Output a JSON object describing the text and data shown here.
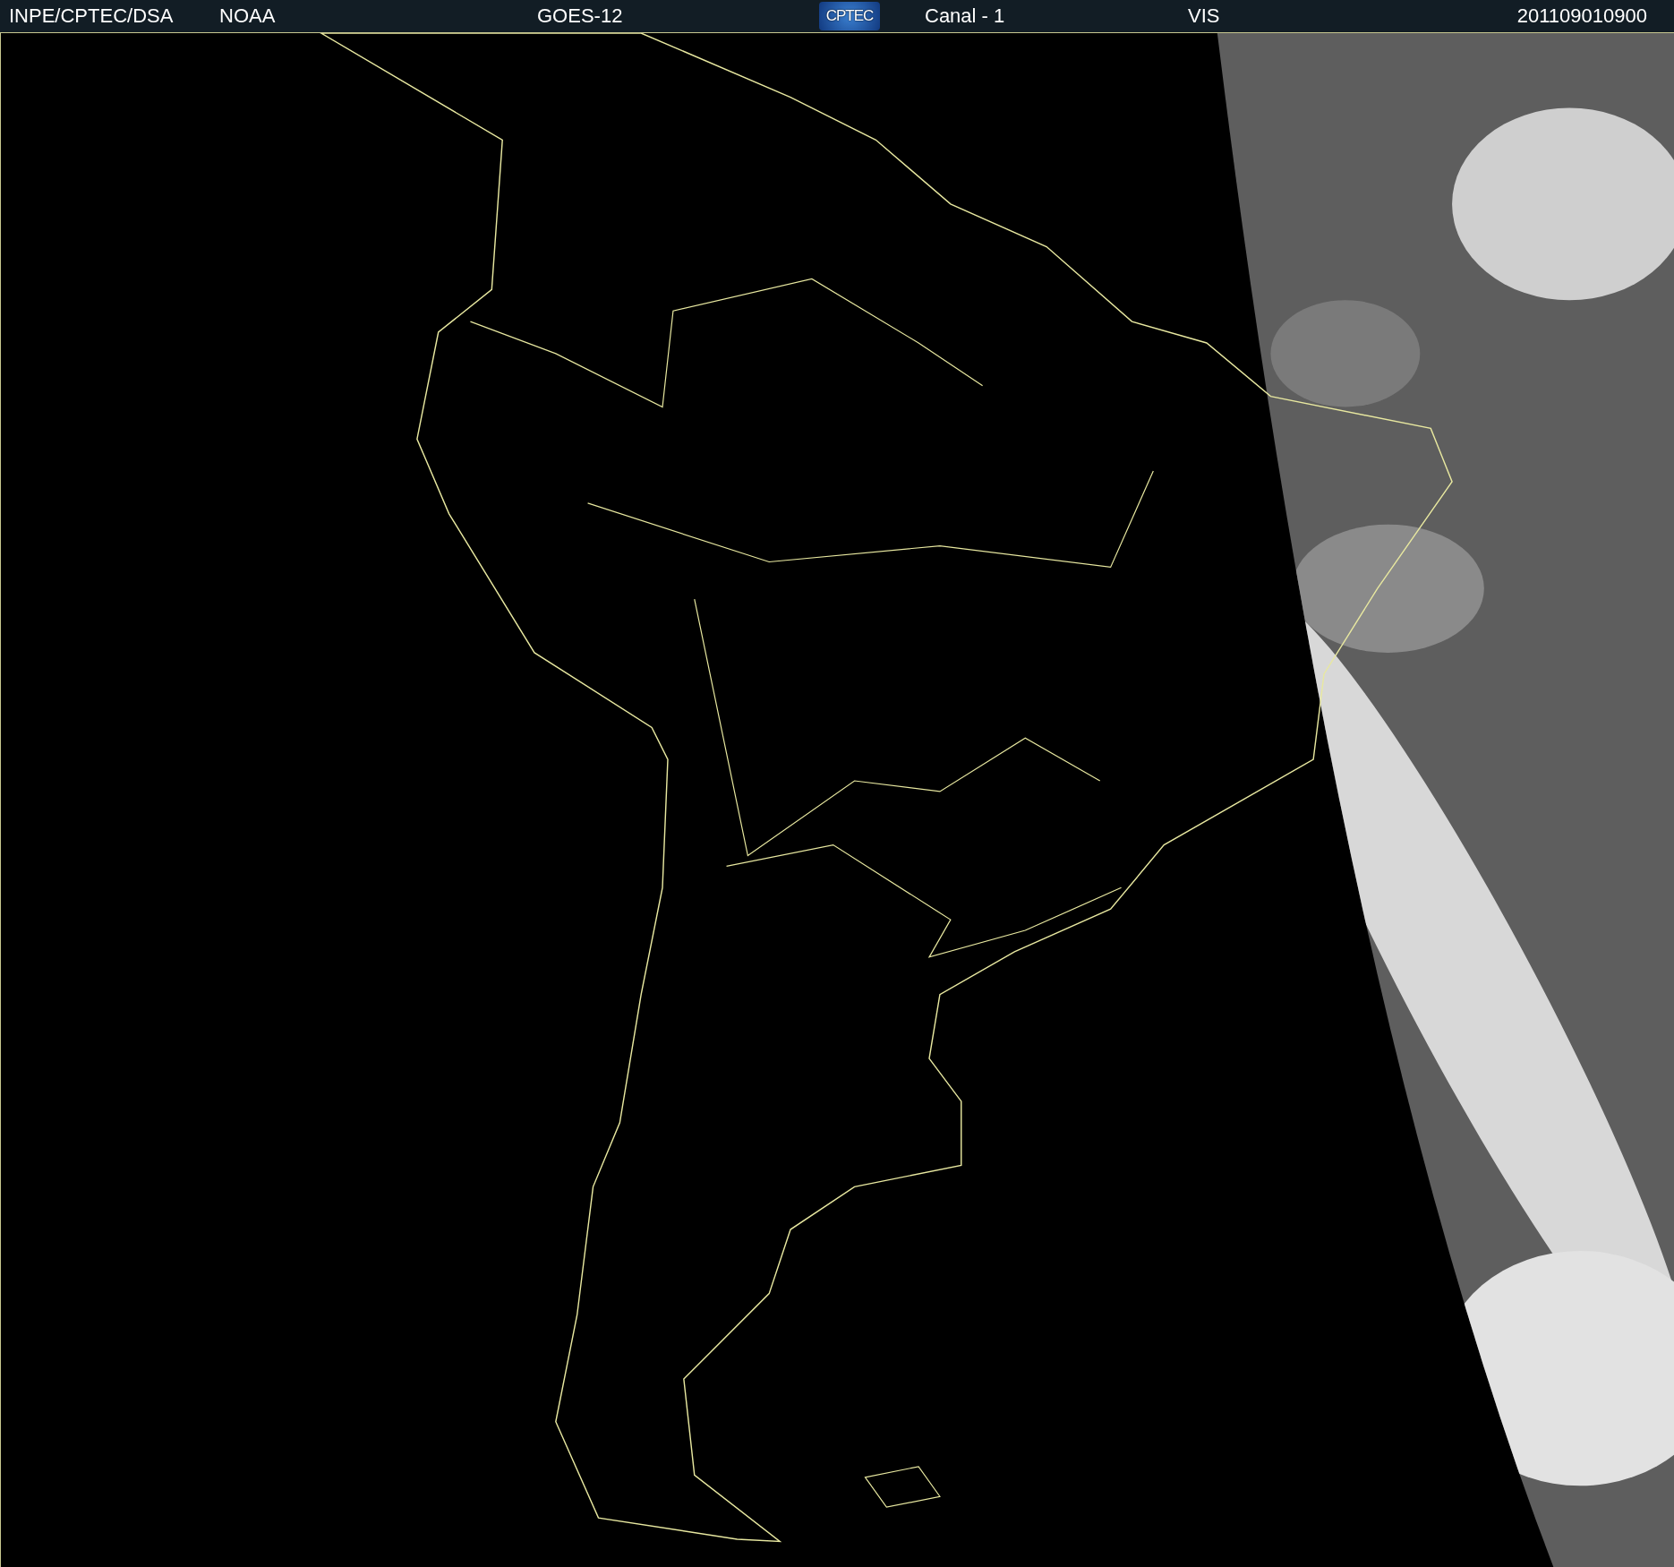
{
  "header": {
    "source": "INPE/CPTEC/DSA",
    "agency": "NOAA",
    "satellite": "GOES-12",
    "logo": "CPTEC",
    "channel": "Canal - 1",
    "band": "VIS",
    "timestamp": "201109010900"
  }
}
